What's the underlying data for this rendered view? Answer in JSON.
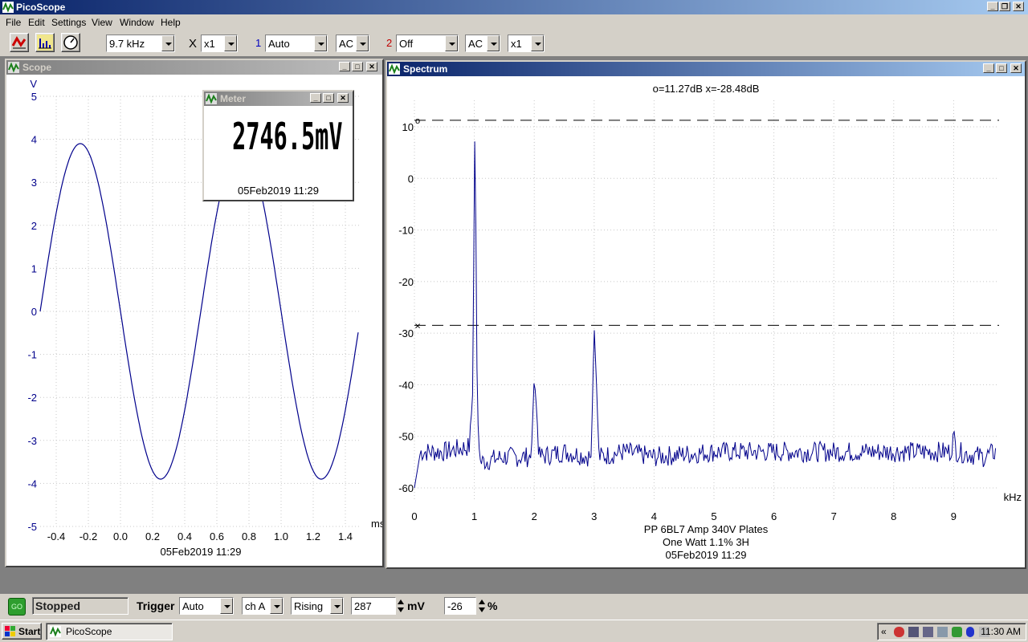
{
  "app": {
    "title": "PicoScope"
  },
  "menu": [
    "File",
    "Edit",
    "Settings",
    "View",
    "Window",
    "Help"
  ],
  "toolbar": {
    "timebase": "9.7 kHz",
    "x_label": "X",
    "x_mult": "x1",
    "ch1_num": "1",
    "ch1_range": "Auto",
    "ch1_coupling": "AC",
    "ch2_num": "2",
    "ch2_range": "Off",
    "ch2_coupling": "AC",
    "ch2_mult": "x1"
  },
  "scope": {
    "title": "Scope",
    "y_unit": "V",
    "x_unit": "ms",
    "y_ticks": [
      "5",
      "4",
      "3",
      "2",
      "1",
      "0",
      "-1",
      "-2",
      "-3",
      "-4",
      "-5"
    ],
    "x_ticks": [
      "-0.4",
      "-0.2",
      "0.0",
      "0.2",
      "0.4",
      "0.6",
      "0.8",
      "1.0",
      "1.2",
      "1.4"
    ],
    "timestamp": "05Feb2019  11:29",
    "color": "#00008b"
  },
  "meter": {
    "title": "Meter",
    "value": "2746.5mV",
    "timestamp": "05Feb2019  11:29"
  },
  "spectrum": {
    "title": "Spectrum",
    "readout": "o=11.27dB  x=-28.48dB",
    "y_ticks": [
      "10",
      "0",
      "-10",
      "-20",
      "-30",
      "-40",
      "-50",
      "-60"
    ],
    "x_ticks": [
      "0",
      "1",
      "2",
      "3",
      "4",
      "5",
      "6",
      "7",
      "8",
      "9"
    ],
    "x_unit": "kHz",
    "caption1": "PP 6BL7  Amp 340V Plates",
    "caption2": "One Watt 1.1% 3H",
    "caption3": "05Feb2019  11:29",
    "marker_o": "o",
    "marker_x": "×",
    "color": "#00008b"
  },
  "chart_data": [
    {
      "type": "line",
      "title": "Scope",
      "xlabel": "ms",
      "ylabel": "V",
      "xlim": [
        -0.5,
        1.5
      ],
      "ylim": [
        -5,
        5
      ],
      "series": [
        {
          "x": [
            -0.5,
            -0.4,
            -0.3,
            -0.24,
            -0.1,
            0.0,
            0.1,
            0.2,
            0.26,
            0.4,
            0.5,
            0.6,
            0.76,
            0.9,
            1.0,
            1.1,
            1.24,
            1.4,
            1.48
          ],
          "values": [
            -1.0,
            2.2,
            3.7,
            3.9,
            2.4,
            0.0,
            -2.4,
            -3.7,
            -3.9,
            -2.3,
            0.0,
            2.3,
            3.9,
            2.4,
            0.0,
            -2.4,
            -3.9,
            -2.3,
            -0.1
          ]
        }
      ]
    },
    {
      "type": "line",
      "title": "Spectrum",
      "xlabel": "kHz",
      "xlim": [
        0,
        9.7
      ],
      "ylim": [
        -62,
        12
      ],
      "series": [
        {
          "x": [
            0.0,
            0.1,
            0.5,
            0.92,
            0.98,
            1.0,
            1.02,
            1.05,
            1.1,
            1.5,
            1.95,
            2.0,
            2.04,
            2.08,
            2.5,
            2.95,
            3.0,
            3.04,
            3.08,
            3.5,
            4.0,
            5.0,
            6.0,
            7.0,
            8.0,
            8.95,
            9.0,
            9.05,
            9.5,
            9.7
          ],
          "values": [
            -60,
            -53,
            -53,
            -52,
            -40,
            11.3,
            0,
            -45,
            -55,
            -54,
            -54,
            -38.5,
            -45,
            -54,
            -53,
            -54,
            -28.5,
            -40,
            -54,
            -53,
            -54,
            -53,
            -53,
            -53,
            -53,
            -53,
            -50,
            -53,
            -54,
            -53
          ]
        }
      ],
      "markers": {
        "o": 11.27,
        "x": -28.48
      }
    }
  ],
  "status": {
    "state_icon": "GO",
    "state": "Stopped",
    "trigger_label": "Trigger",
    "trigger_mode": "Auto",
    "trigger_ch": "ch A",
    "trigger_edge": "Rising",
    "trigger_level": "287",
    "level_unit": "mV",
    "pretrigger": "-26",
    "pretrigger_unit": "%"
  },
  "taskbar": {
    "start": "Start",
    "task": "PicoScope",
    "tray_arrow": "«",
    "clock": "11:30 AM"
  }
}
